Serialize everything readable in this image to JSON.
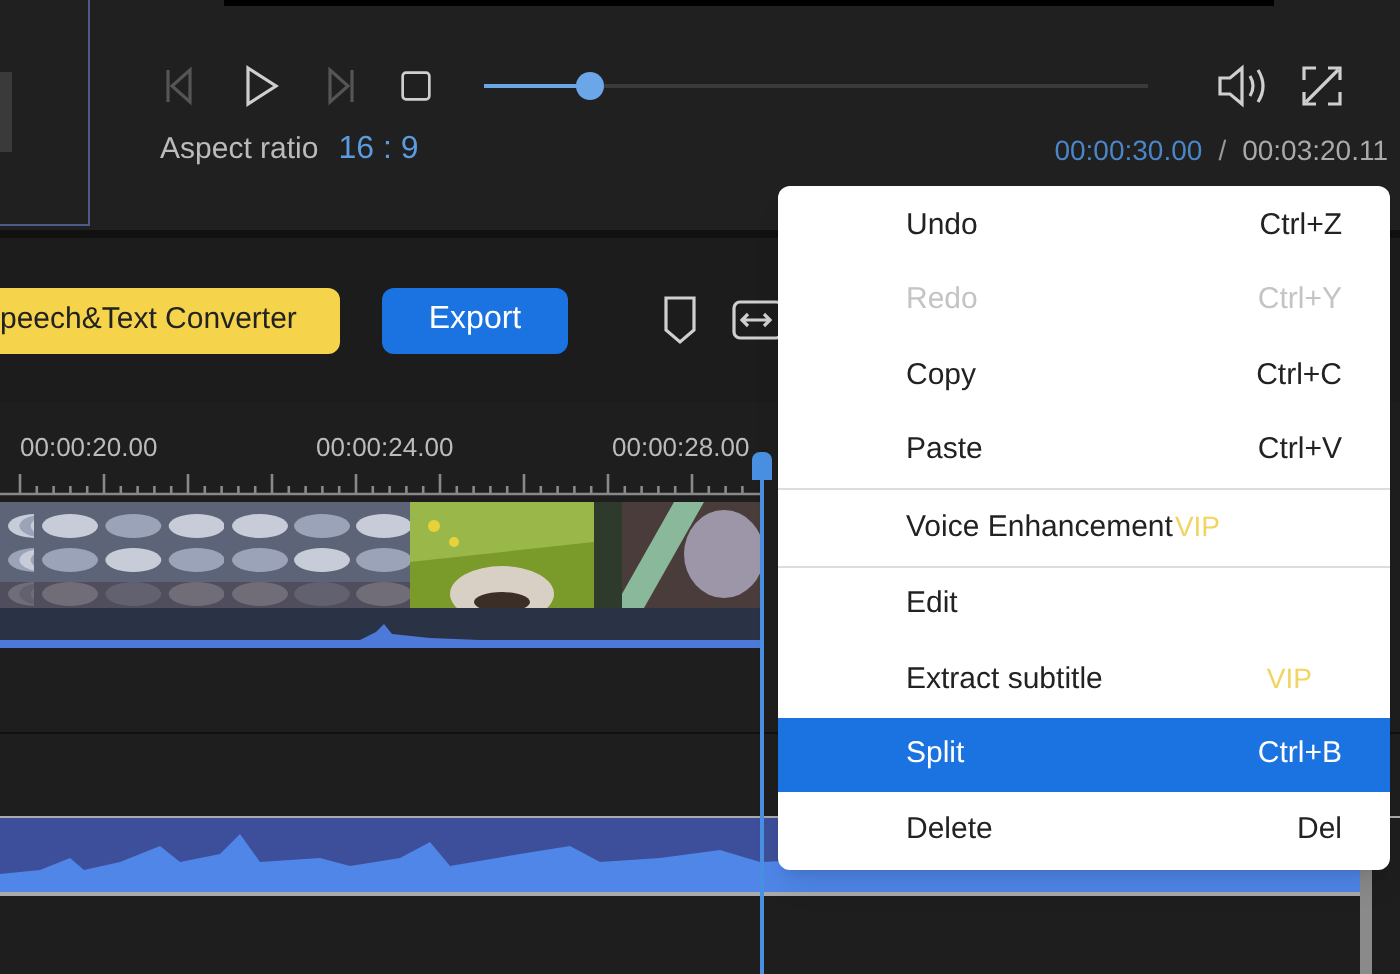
{
  "player": {
    "controls": [
      {
        "kind": "previous",
        "disabled": true
      },
      {
        "kind": "play",
        "disabled": false
      },
      {
        "kind": "next",
        "disabled": true
      },
      {
        "kind": "stop",
        "disabled": false
      }
    ],
    "progress": {
      "level": 0.16
    },
    "aspect_ratio": {
      "label": "Aspect ratio",
      "value": "16 : 9"
    },
    "time": {
      "current": "00:00:30.00",
      "separator": "/",
      "total": "00:03:20.11"
    }
  },
  "toolbar": {
    "buttons": [
      {
        "kind": "yellow",
        "label": "peech&Text Converter"
      },
      {
        "kind": "blue",
        "label": "Export"
      }
    ]
  },
  "ruler": {
    "labels": [
      "00:00:20.00",
      "00:00:24.00",
      "00:00:28.00"
    ]
  },
  "context_menu": {
    "sections": [
      [
        {
          "label": "Undo",
          "shortcut": "Ctrl+Z",
          "disabled": false,
          "selected": false
        },
        {
          "label": "Redo",
          "shortcut": "Ctrl+Y",
          "disabled": true,
          "selected": false
        },
        {
          "label": "Copy",
          "shortcut": "Ctrl+C",
          "disabled": false,
          "selected": false
        },
        {
          "label": "Paste",
          "shortcut": "Ctrl+V",
          "disabled": false,
          "selected": false
        }
      ],
      [
        {
          "label": "Voice Enhancement",
          "badge": "VIP",
          "disabled": false,
          "selected": false
        }
      ],
      [
        {
          "label": "Edit",
          "disabled": false,
          "selected": false
        },
        {
          "label": "Extract subtitle",
          "badge": "VIP",
          "disabled": false,
          "selected": false
        },
        {
          "label": "Split",
          "shortcut": "Ctrl+B",
          "disabled": false,
          "selected": true
        },
        {
          "label": "Delete",
          "shortcut": "Del",
          "disabled": false,
          "selected": false
        }
      ]
    ]
  }
}
